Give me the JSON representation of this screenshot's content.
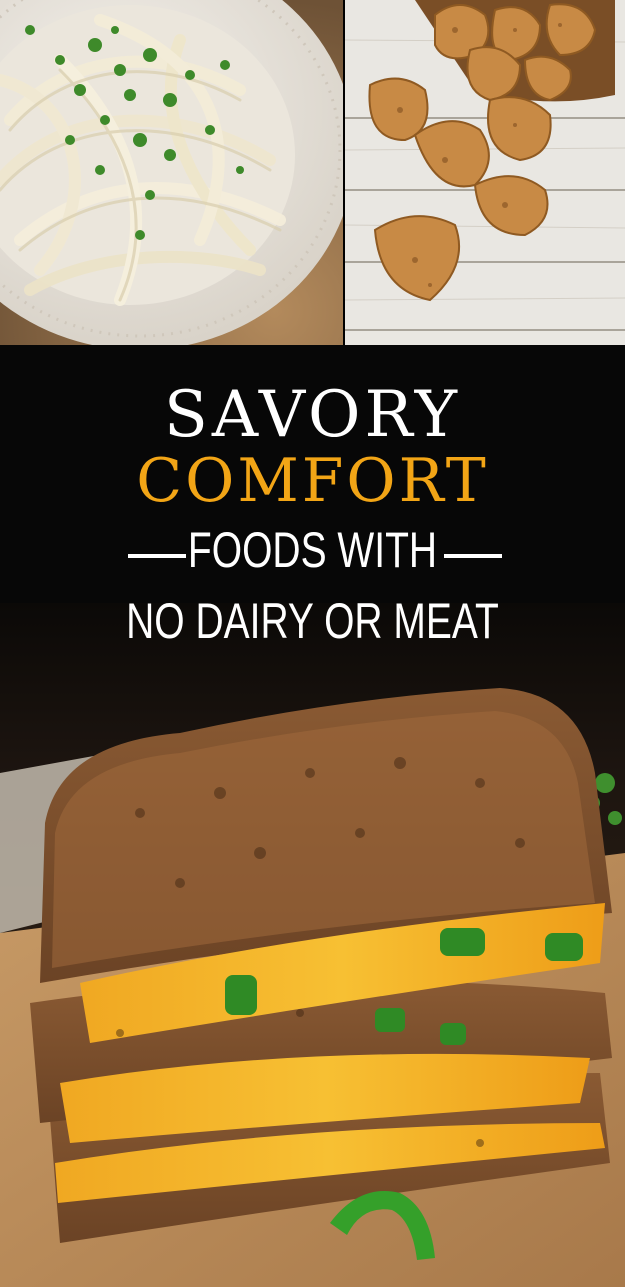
{
  "headline": {
    "line1": "SAVORY",
    "line2": "COMFORT",
    "line3": "FOODS WITH",
    "line4": "NO DAIRY OR MEAT"
  },
  "colors": {
    "accent": "#f2a516",
    "banner_bg": "#070707",
    "text": "#ffffff"
  },
  "images": {
    "top_left": "fettuccine-alfredo-photo",
    "top_right": "breaded-nuggets-photo",
    "bottom": "grilled-cheese-jalapeno-photo"
  }
}
